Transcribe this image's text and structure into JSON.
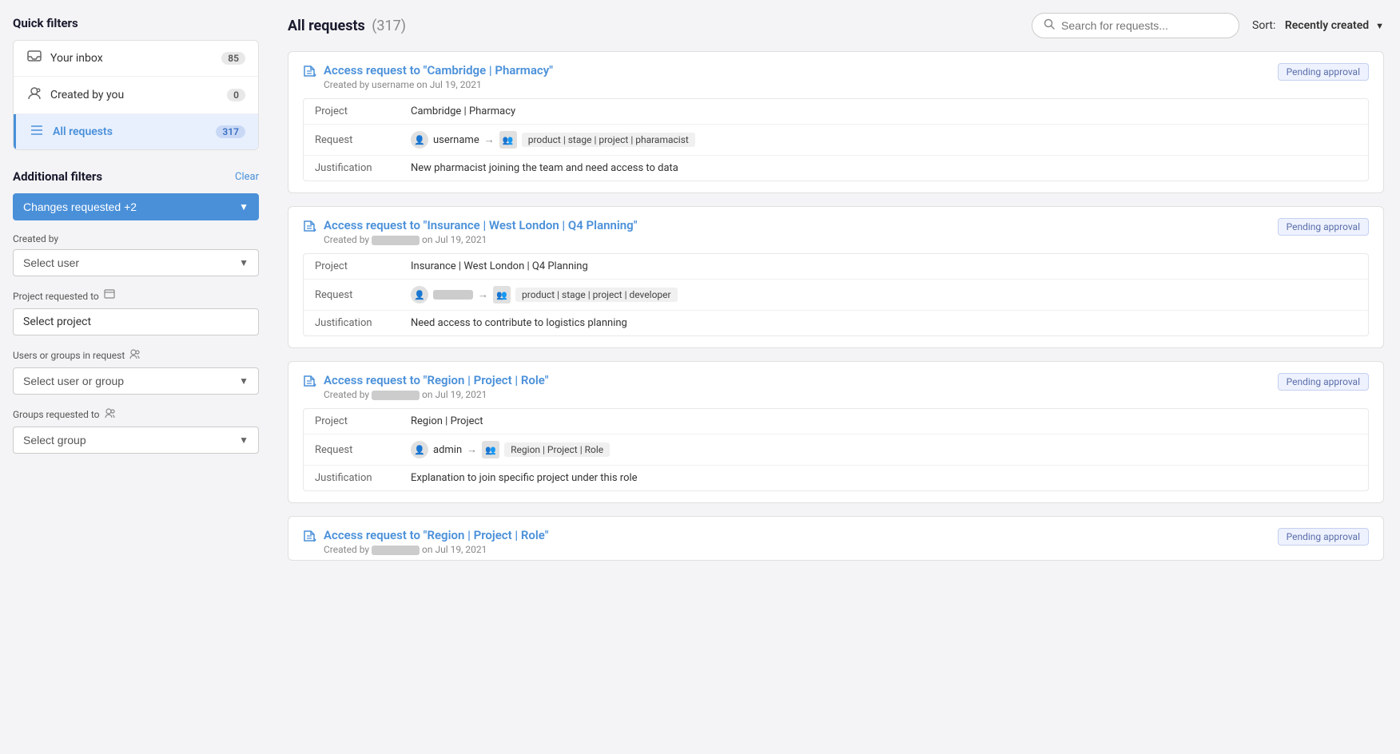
{
  "sidebar": {
    "quick_filters_title": "Quick filters",
    "quick_filters": [
      {
        "id": "inbox",
        "label": "Your inbox",
        "count": "85",
        "icon": "📥",
        "active": false
      },
      {
        "id": "created-by-you",
        "label": "Created by you",
        "count": "0",
        "icon": "👤",
        "active": false
      },
      {
        "id": "all-requests",
        "label": "All requests",
        "count": "317",
        "icon": "≡",
        "active": true
      }
    ],
    "additional_filters_title": "Additional filters",
    "clear_label": "Clear",
    "changes_requested_label": "Changes requested +2",
    "created_by_label": "Created by",
    "select_user_placeholder": "Select user",
    "project_requested_label": "Project requested to",
    "select_project_placeholder": "Select project",
    "users_groups_label": "Users or groups in request",
    "select_user_group_placeholder": "Select user or group",
    "groups_label": "Groups requested to",
    "select_group_placeholder": "Select group"
  },
  "main": {
    "title": "All requests",
    "count": "(317)",
    "search_placeholder": "Search for requests...",
    "sort_label": "Sort:",
    "sort_value": "Recently created",
    "requests": [
      {
        "id": 1,
        "title": "Access request to \"Cambridge | Pharmacy\"",
        "created_by": "username",
        "created_date": "Jul 19, 2021",
        "status": "Pending approval",
        "project": "Cambridge | Pharmacy",
        "request_user": "username",
        "request_target": "product | stage | project | pharamacist",
        "justification": "New pharmacist joining the team and need access to data",
        "user_blurred": false
      },
      {
        "id": 2,
        "title": "Access request to \"Insurance | West London | Q4 Planning\"",
        "created_by": "",
        "created_date": "Jul 19, 2021",
        "status": "Pending approval",
        "project": "Insurance | West London | Q4 Planning",
        "request_user": "",
        "request_target": "product | stage | project | developer",
        "justification": "Need access to contribute to logistics planning",
        "user_blurred": true
      },
      {
        "id": 3,
        "title": "Access request to \"Region | Project | Role\"",
        "created_by": "",
        "created_date": "Jul 19, 2021",
        "status": "Pending approval",
        "project": "Region | Project",
        "request_user": "admin",
        "request_target": "Region | Project | Role",
        "justification": "Explanation to join specific project under this role",
        "user_blurred": false
      },
      {
        "id": 4,
        "title": "Access request to \"Region | Project | Role\"",
        "created_by": "",
        "created_date": "Jul 19, 2021",
        "status": "Pending approval",
        "project": "",
        "request_user": "",
        "request_target": "",
        "justification": "",
        "user_blurred": true,
        "partial": true
      }
    ]
  }
}
